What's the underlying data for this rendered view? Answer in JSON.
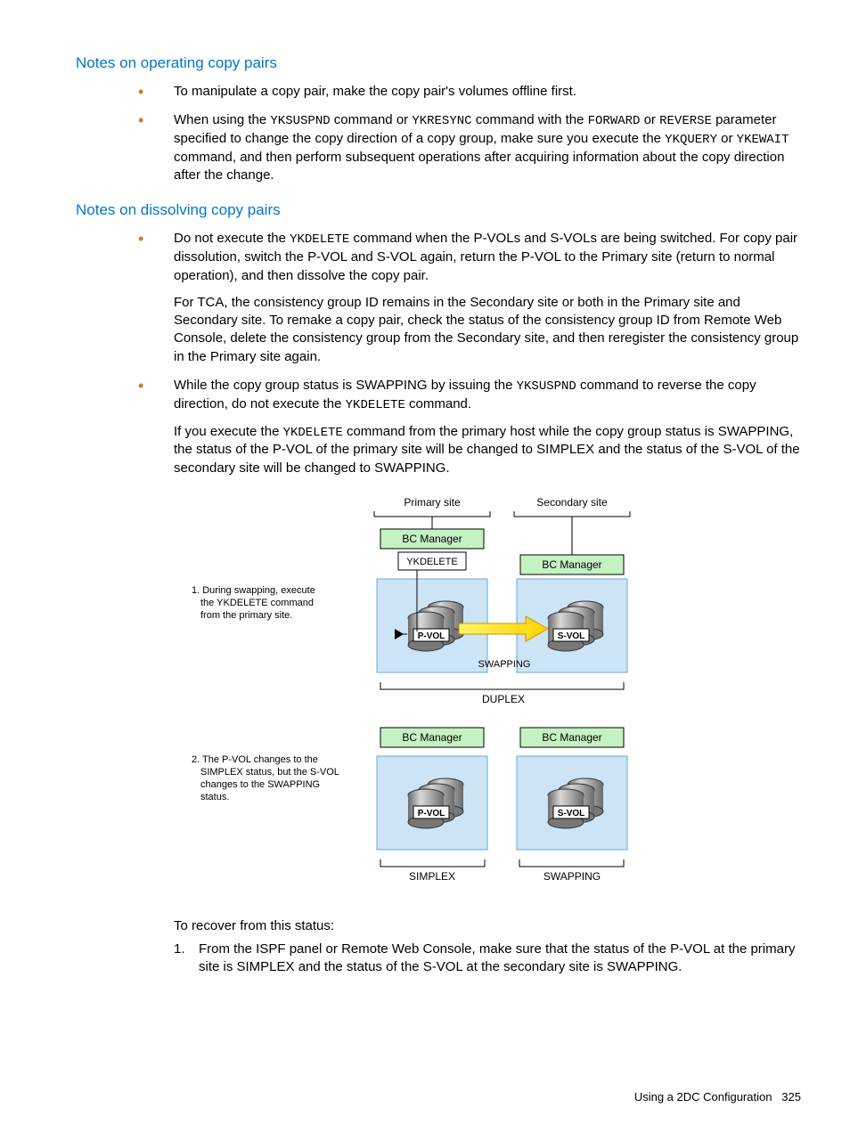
{
  "section1": {
    "title": "Notes on operating copy pairs",
    "items": [
      {
        "text": "To manipulate a copy pair, make the copy pair's volumes offline first."
      },
      {
        "pre": "When using the ",
        "c1": "YKSUSPND",
        "mid1": " command or ",
        "c2": "YKRESYNC",
        "mid2": " command with the ",
        "c3": "FORWARD",
        "mid3": " or ",
        "c4": "REVERSE",
        "mid4": " parameter specified to change the copy direction of a copy group, make sure you execute the ",
        "c5": "YKQUERY",
        "mid5": " or ",
        "c6": "YKEWAIT",
        "post": " command, and then perform subsequent operations after acquiring information about the copy direction after the change."
      }
    ]
  },
  "section2": {
    "title": "Notes on dissolving copy pairs",
    "item1": {
      "pre": "Do not execute the ",
      "c1": "YKDELETE",
      "post": " command when the P-VOLs and S-VOLs are being switched. For copy pair dissolution, switch the P-VOL and S-VOL again, return the P-VOL to the Primary site (return to normal operation), and then dissolve the copy pair."
    },
    "item1_para2": "For TCA, the consistency group ID remains in the Secondary site or both in the Primary site and Secondary site. To remake a copy pair, check the status of the consistency group ID from Remote Web Console, delete the consistency group from the Secondary site, and then reregister the consistency group in the Primary site again.",
    "item2": {
      "pre": "While the copy group status is SWAPPING by issuing the ",
      "c1": "YKSUSPND",
      "mid1": " command to reverse the copy direction, do not execute the ",
      "c2": "YKDELETE",
      "post": " command."
    },
    "item2_para2": {
      "pre": "If you execute the ",
      "c1": "YKDELETE",
      "post": " command from the primary host while the copy group status is SWAPPING, the status of the P-VOL of the primary site will be changed to SIMPLEX and the status of the S-VOL of the secondary site will be changed to SWAPPING."
    }
  },
  "diagram": {
    "primary_site": "Primary site",
    "secondary_site": "Secondary site",
    "bc_manager": "BC Manager",
    "ykdelete": "YKDELETE",
    "pvol": "P-VOL",
    "svol": "S-VOL",
    "swapping": "SWAPPING",
    "duplex": "DUPLEX",
    "simplex": "SIMPLEX",
    "note1_l1": "1. During swapping, execute",
    "note1_l2": "the YKDELETE command",
    "note1_l3": "from the primary site.",
    "note2_l1": "2. The P-VOL changes to the",
    "note2_l2": "SIMPLEX status, but the S-VOL",
    "note2_l3": "changes to the SWAPPING",
    "note2_l4": "status."
  },
  "recover": {
    "intro": "To recover from this status:",
    "step1_num": "1.",
    "step1": "From the ISPF panel or Remote Web Console, make sure that the status of the P-VOL at the primary site is SIMPLEX and the status of the S-VOL at the secondary site is SWAPPING."
  },
  "footer": {
    "label": "Using a 2DC Configuration",
    "page": "325"
  }
}
